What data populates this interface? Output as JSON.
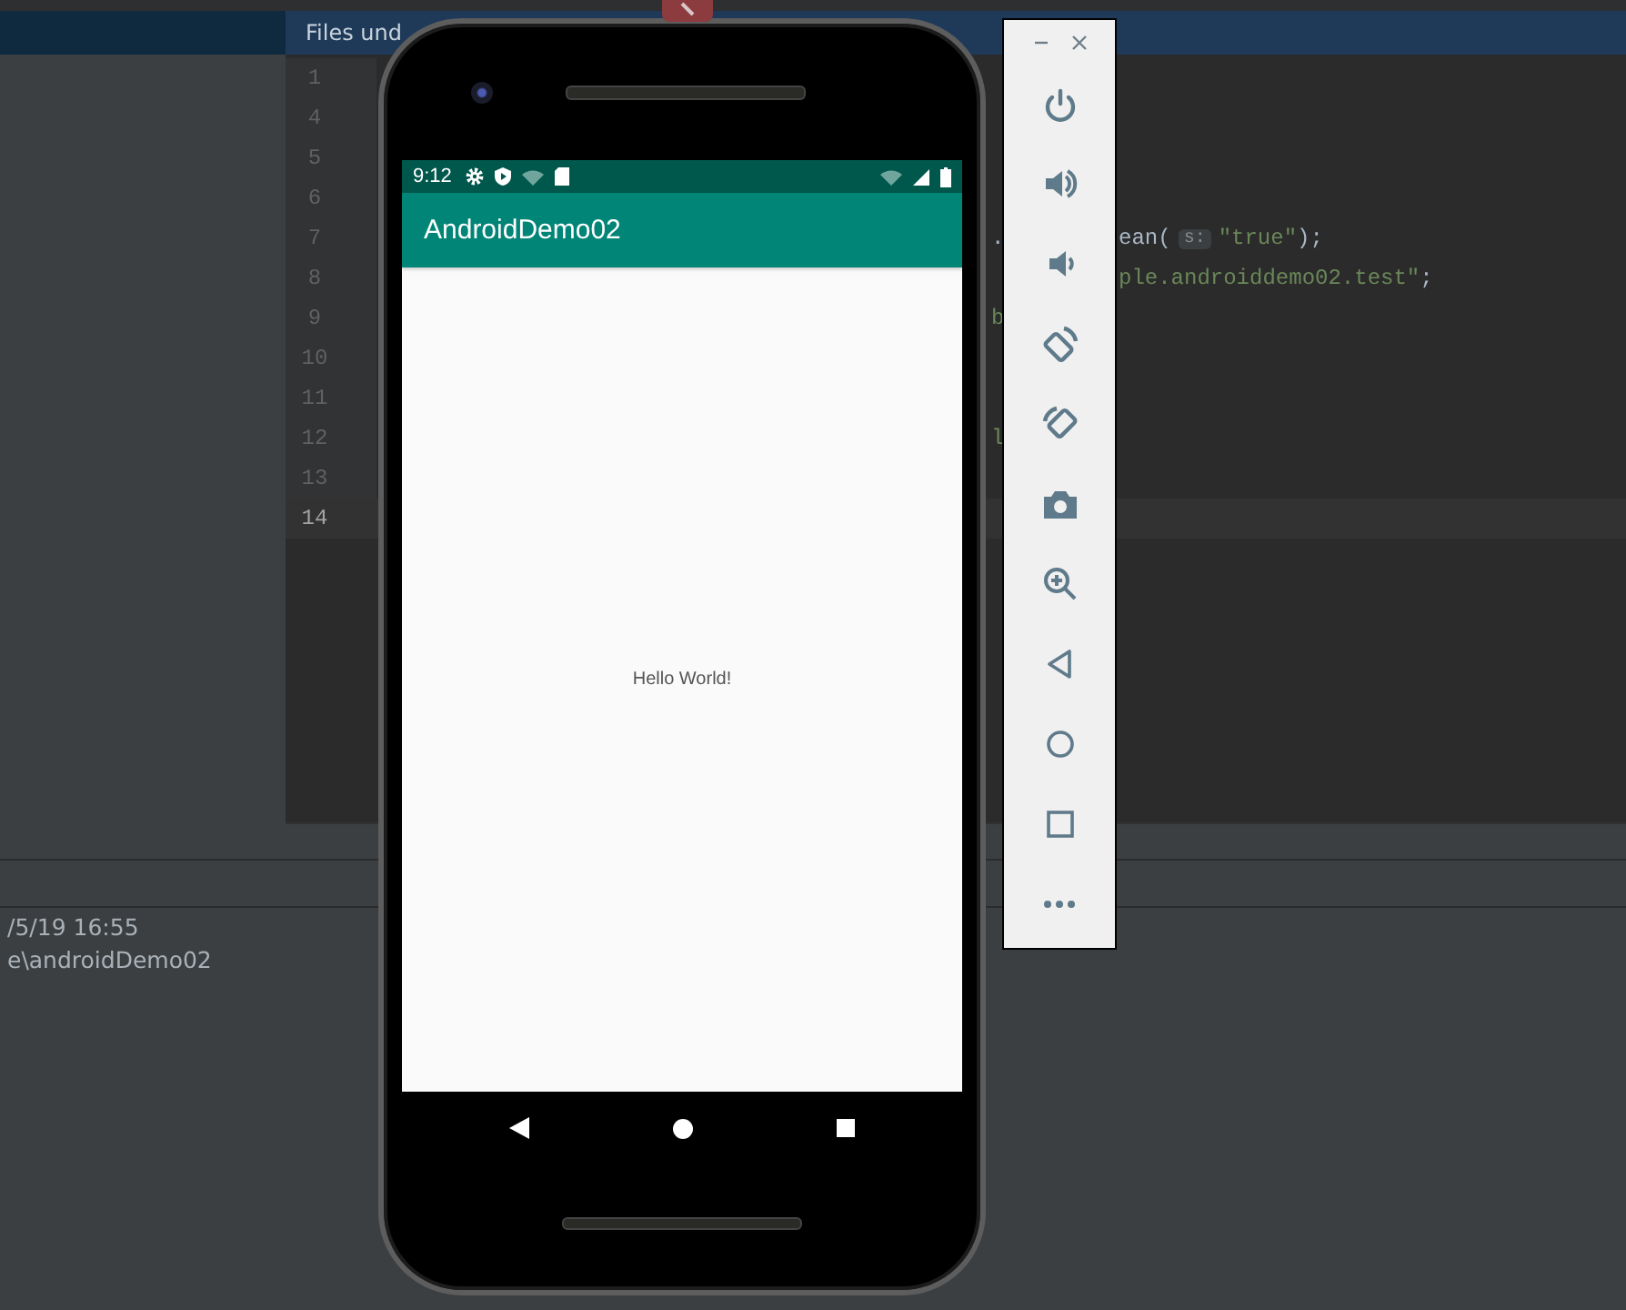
{
  "ide": {
    "banner": "Files und",
    "lines": [
      {
        "number": "1",
        "selected": false
      },
      {
        "number": "4",
        "selected": false
      },
      {
        "number": "5",
        "selected": false
      },
      {
        "number": "6",
        "selected": false
      },
      {
        "number": "7",
        "selected": false,
        "before": [
          {
            "kind": "plain",
            "text": "."
          }
        ],
        "after": [
          {
            "kind": "plain",
            "text": "ean("
          },
          {
            "kind": "hint",
            "text": "s:"
          },
          {
            "kind": "string",
            "text": "\"true\""
          },
          {
            "kind": "plain",
            "text": ");"
          }
        ]
      },
      {
        "number": "8",
        "selected": false,
        "after": [
          {
            "kind": "string",
            "text": "ple.androiddemo02.test\""
          },
          {
            "kind": "plain",
            "text": ";"
          }
        ]
      },
      {
        "number": "9",
        "selected": false,
        "before": [
          {
            "kind": "string",
            "text": "b"
          }
        ]
      },
      {
        "number": "10",
        "selected": false
      },
      {
        "number": "11",
        "selected": false
      },
      {
        "number": "12",
        "selected": false,
        "before": [
          {
            "kind": "string",
            "text": "l"
          }
        ]
      },
      {
        "number": "13",
        "selected": false
      },
      {
        "number": "14",
        "selected": true
      }
    ],
    "log": [
      "/5/19 16:55",
      "e\\androidDemo02"
    ]
  },
  "emulator": {
    "time": "9:12",
    "app_title": "AndroidDemo02",
    "content_text": "Hello World!"
  },
  "toolbar": {
    "buttons": [
      {
        "kind": "power"
      },
      {
        "kind": "volume_up"
      },
      {
        "kind": "volume_down"
      },
      {
        "kind": "rotate_left"
      },
      {
        "kind": "rotate_right"
      },
      {
        "kind": "screenshot"
      },
      {
        "kind": "zoom"
      },
      {
        "kind": "back"
      },
      {
        "kind": "home"
      },
      {
        "kind": "overview"
      },
      {
        "kind": "more"
      }
    ]
  }
}
